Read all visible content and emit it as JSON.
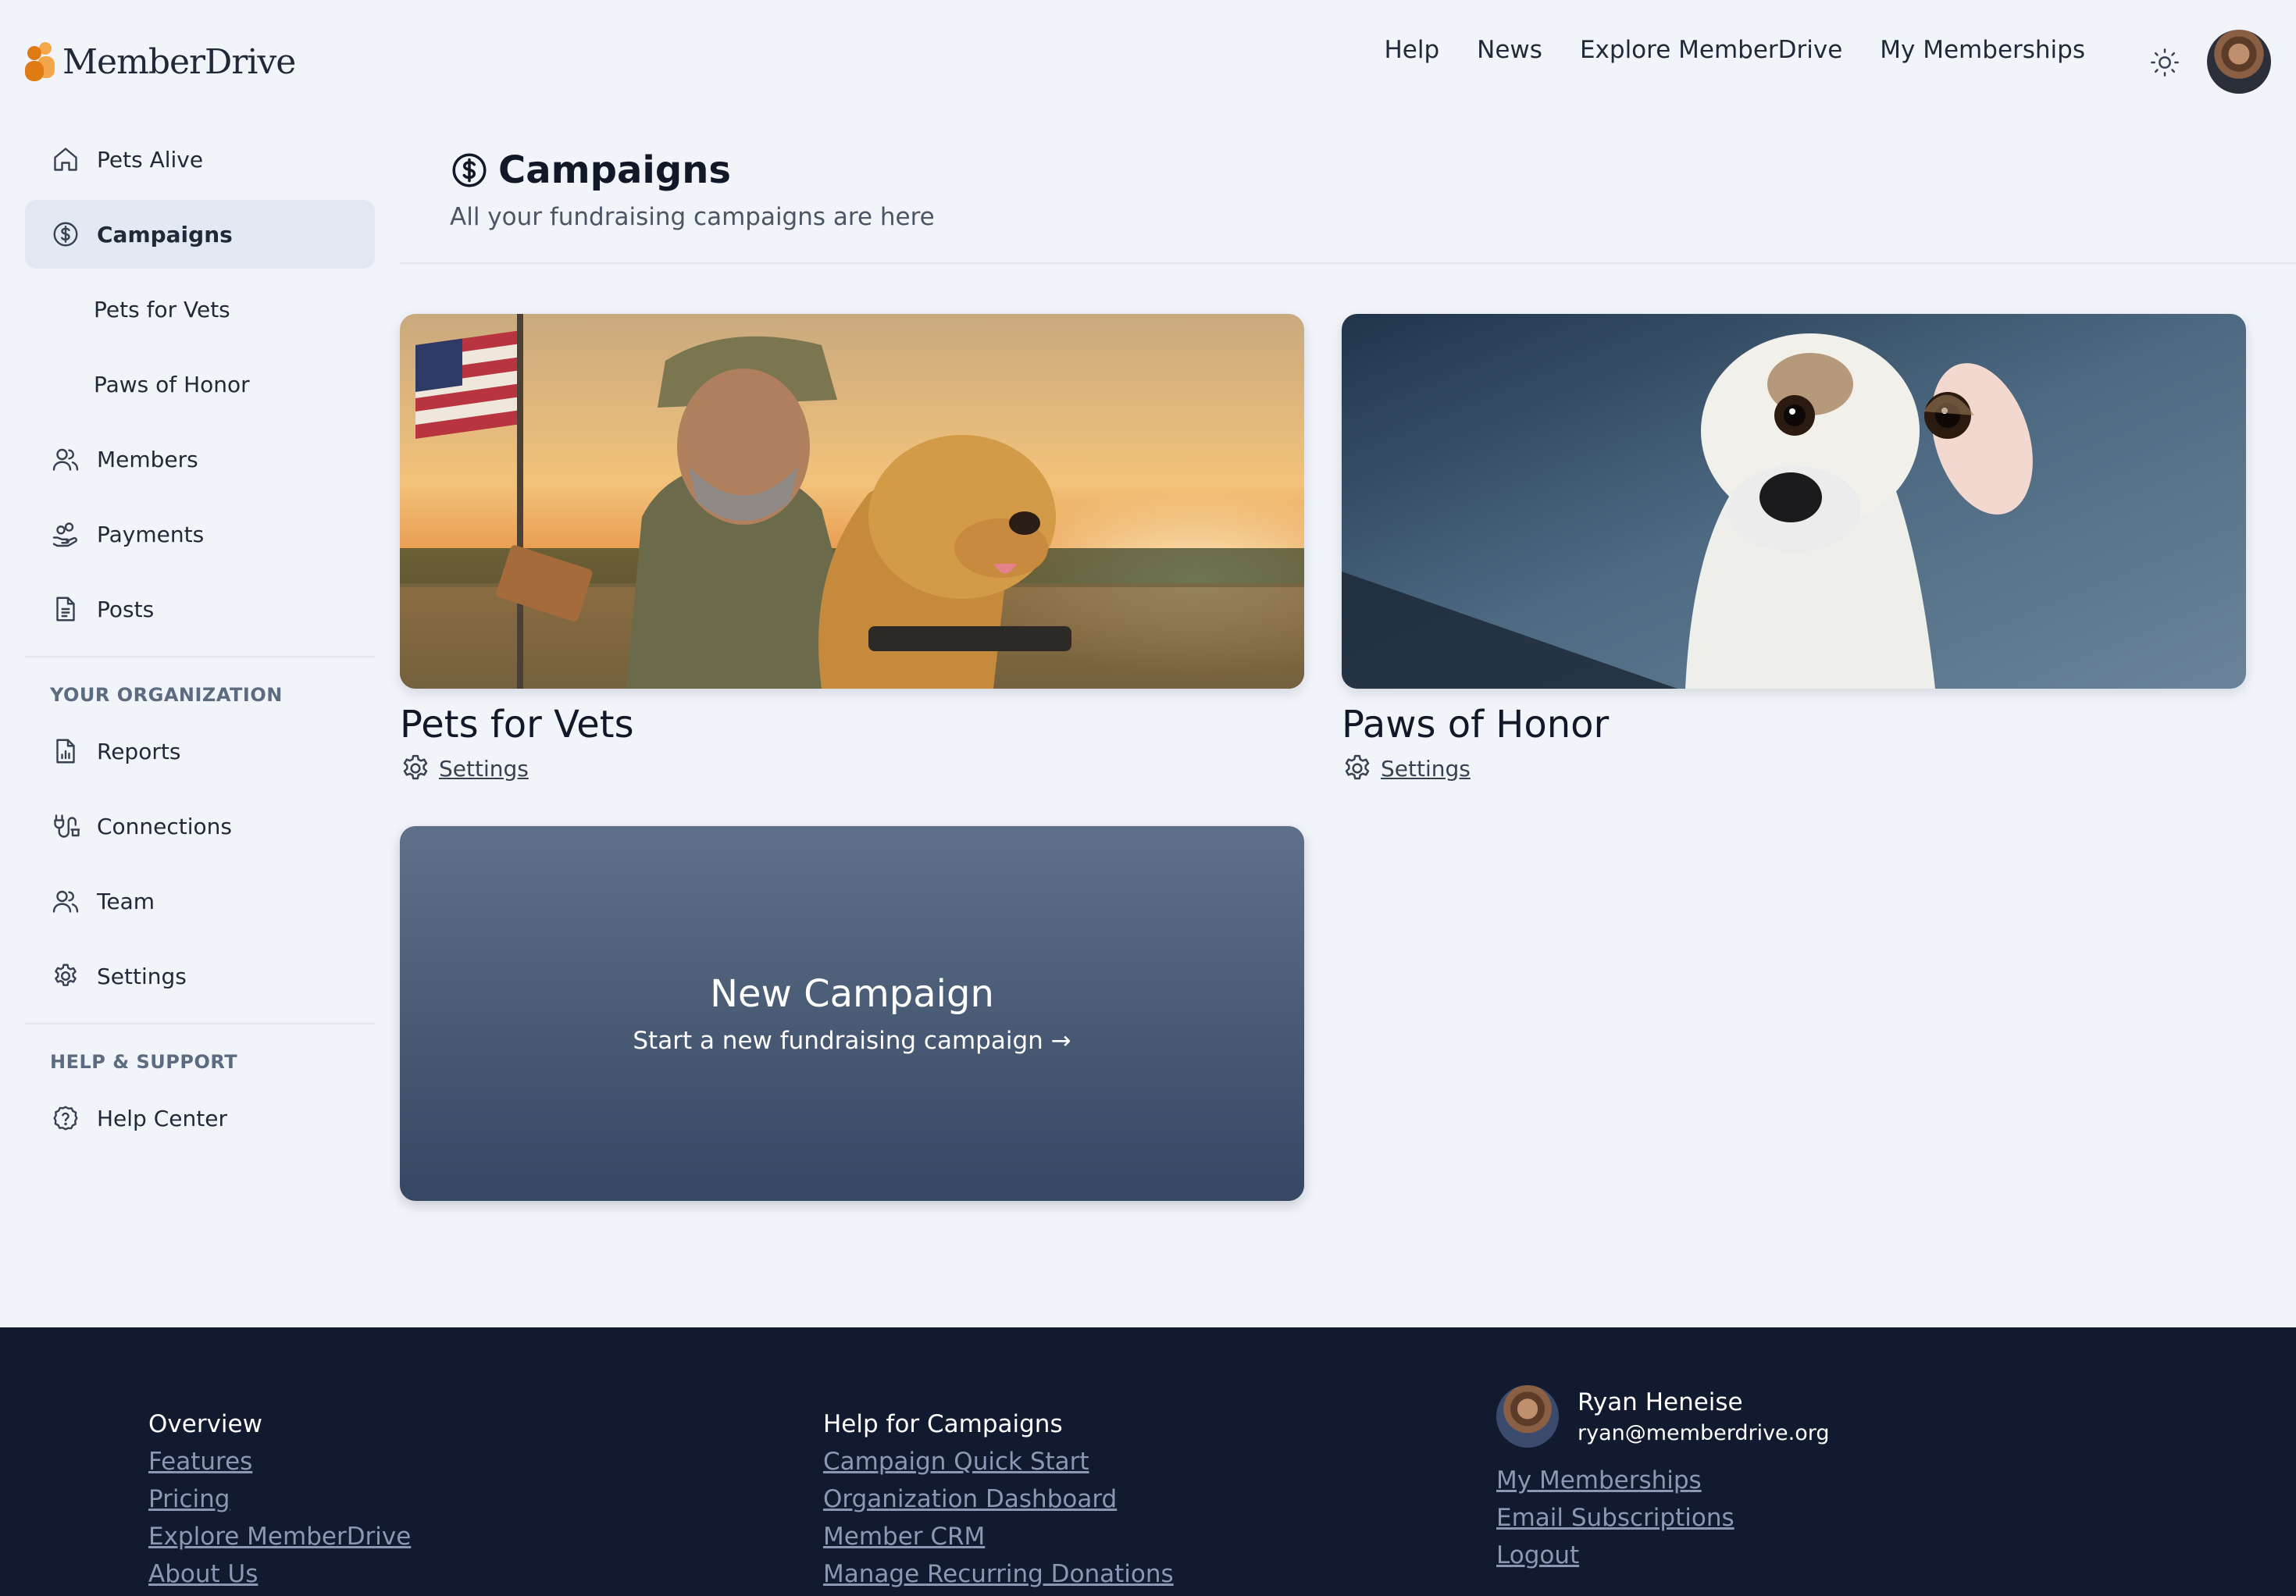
{
  "header": {
    "logo_text": "MemberDrive",
    "nav": [
      "Help",
      "News",
      "Explore MemberDrive",
      "My Memberships"
    ]
  },
  "sidebar": {
    "items": [
      {
        "label": "Pets Alive",
        "icon": "home-icon"
      },
      {
        "label": "Campaigns",
        "icon": "dollar-circle-icon",
        "active": true
      },
      {
        "label": "Pets for Vets"
      },
      {
        "label": "Paws of Honor"
      },
      {
        "label": "Members",
        "icon": "users-icon"
      },
      {
        "label": "Payments",
        "icon": "hand-coins-icon"
      },
      {
        "label": "Posts",
        "icon": "document-icon"
      }
    ],
    "org_label": "YOUR ORGANIZATION",
    "org_items": [
      {
        "label": "Reports",
        "icon": "report-icon"
      },
      {
        "label": "Connections",
        "icon": "plug-icon"
      },
      {
        "label": "Team",
        "icon": "users-icon"
      },
      {
        "label": "Settings",
        "icon": "gear-icon"
      }
    ],
    "help_label": "HELP & SUPPORT",
    "help_items": [
      {
        "label": "Help Center",
        "icon": "question-circle-icon"
      }
    ]
  },
  "page": {
    "title": "Campaigns",
    "subtitle": "All your fundraising campaigns are here"
  },
  "campaigns": [
    {
      "title": "Pets for Vets",
      "settings_label": "Settings"
    },
    {
      "title": "Paws of Honor",
      "settings_label": "Settings"
    }
  ],
  "new_campaign": {
    "title": "New Campaign",
    "subtitle": "Start a new fundraising campaign →"
  },
  "footer": {
    "overview": {
      "heading": "Overview",
      "links": [
        "Features",
        "Pricing",
        "Explore MemberDrive",
        "About Us"
      ]
    },
    "help": {
      "heading": "Help for Campaigns",
      "links": [
        "Campaign Quick Start",
        "Organization Dashboard",
        "Member CRM",
        "Manage Recurring Donations"
      ]
    },
    "user": {
      "name": "Ryan Heneise",
      "email": "ryan@memberdrive.org",
      "links": [
        "My Memberships",
        "Email Subscriptions",
        "Logout"
      ]
    }
  },
  "colors": {
    "page_bg": "#f1f4f9",
    "footer_bg": "#111a2e",
    "active_bg": "#e3e9f3",
    "logo_orange": "#e07b14"
  }
}
